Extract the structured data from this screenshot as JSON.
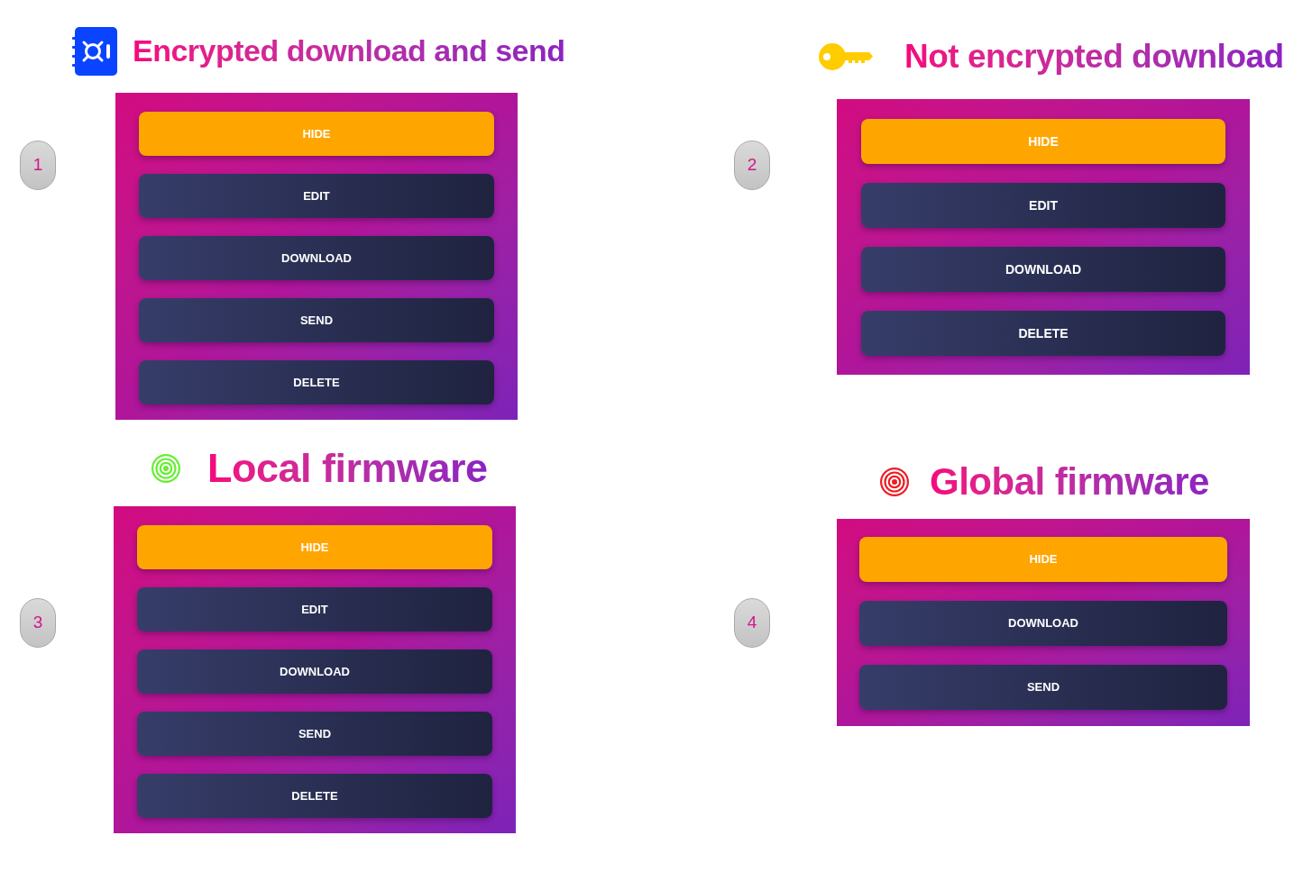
{
  "sections": [
    {
      "number": "1",
      "title": "Encrypted download and send",
      "icon": {
        "kind": "vault",
        "color": "#0b44ff"
      },
      "buttons": [
        {
          "label": "HIDE",
          "kind": "accent"
        },
        {
          "label": "EDIT",
          "kind": "dark"
        },
        {
          "label": "DOWNLOAD",
          "kind": "dark"
        },
        {
          "label": "SEND",
          "kind": "dark"
        },
        {
          "label": "DELETE",
          "kind": "dark"
        }
      ]
    },
    {
      "number": "2",
      "title": "Not encrypted download",
      "icon": {
        "kind": "key",
        "color": "#ffcc00"
      },
      "buttons": [
        {
          "label": "HIDE",
          "kind": "accent"
        },
        {
          "label": "EDIT",
          "kind": "dark"
        },
        {
          "label": "DOWNLOAD",
          "kind": "dark"
        },
        {
          "label": "DELETE",
          "kind": "dark"
        }
      ]
    },
    {
      "number": "3",
      "title": "Local firmware",
      "icon": {
        "kind": "target",
        "color": "#66ee33"
      },
      "buttons": [
        {
          "label": "HIDE",
          "kind": "accent"
        },
        {
          "label": "EDIT",
          "kind": "dark"
        },
        {
          "label": "DOWNLOAD",
          "kind": "dark"
        },
        {
          "label": "SEND",
          "kind": "dark"
        },
        {
          "label": "DELETE",
          "kind": "dark"
        }
      ]
    },
    {
      "number": "4",
      "title": "Global firmware",
      "icon": {
        "kind": "target",
        "color": "#ee1c24"
      },
      "buttons": [
        {
          "label": "HIDE",
          "kind": "accent"
        },
        {
          "label": "DOWNLOAD",
          "kind": "dark"
        },
        {
          "label": "SEND",
          "kind": "dark"
        }
      ]
    }
  ]
}
